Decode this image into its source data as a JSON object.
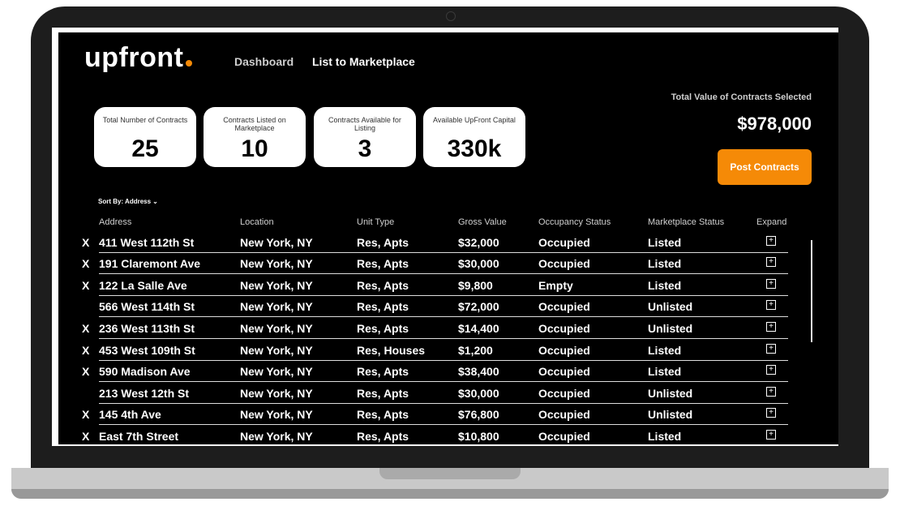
{
  "app": {
    "logo_text": "upfront",
    "accent_color": "#f58a07"
  },
  "nav": {
    "dashboard": "Dashboard",
    "list_to_marketplace": "List to Marketplace"
  },
  "stats": [
    {
      "label": "Total Number of Contracts",
      "value": "25"
    },
    {
      "label": "Contracts Listed on Marketplace",
      "value": "10"
    },
    {
      "label": "Contracts Available for Listing",
      "value": "3"
    },
    {
      "label": "Available UpFront Capital",
      "value": "330k"
    }
  ],
  "summary": {
    "total_label": "Total Value of Contracts Selected",
    "total_value": "$978,000",
    "post_button": "Post Contracts"
  },
  "sort": {
    "label": "Sort By: Address"
  },
  "table": {
    "headers": [
      "Address",
      "Location",
      "Unit Type",
      "Gross Value",
      "Occupancy Status",
      "Marketplace Status",
      "Expand"
    ],
    "rows": [
      {
        "selected": "X",
        "address": "411 West 112th St",
        "location": "New York, NY",
        "unit_type": "Res, Apts",
        "gross_value": "$32,000",
        "occupancy": "Occupied",
        "marketplace": "Listed"
      },
      {
        "selected": "X",
        "address": "191 Claremont Ave",
        "location": "New York, NY",
        "unit_type": "Res, Apts",
        "gross_value": "$30,000",
        "occupancy": "Occupied",
        "marketplace": "Listed"
      },
      {
        "selected": "X",
        "address": "122 La Salle Ave",
        "location": "New York, NY",
        "unit_type": "Res, Apts",
        "gross_value": "$9,800",
        "occupancy": "Empty",
        "marketplace": "Listed"
      },
      {
        "selected": "",
        "address": "566 West 114th St",
        "location": "New York, NY",
        "unit_type": "Res, Apts",
        "gross_value": "$72,000",
        "occupancy": "Occupied",
        "marketplace": "Unlisted"
      },
      {
        "selected": "X",
        "address": "236 West 113th St",
        "location": "New York, NY",
        "unit_type": "Res, Apts",
        "gross_value": "$14,400",
        "occupancy": "Occupied",
        "marketplace": "Unlisted"
      },
      {
        "selected": "X",
        "address": "453 West 109th St",
        "location": "New York, NY",
        "unit_type": "Res, Houses",
        "gross_value": "$1,200",
        "occupancy": "Occupied",
        "marketplace": "Listed"
      },
      {
        "selected": "X",
        "address": "590 Madison Ave",
        "location": "New York, NY",
        "unit_type": "Res, Apts",
        "gross_value": "$38,400",
        "occupancy": "Occupied",
        "marketplace": "Listed"
      },
      {
        "selected": "",
        "address": "213 West 12th St",
        "location": "New York, NY",
        "unit_type": "Res, Apts",
        "gross_value": "$30,000",
        "occupancy": "Occupied",
        "marketplace": "Unlisted"
      },
      {
        "selected": "X",
        "address": "145 4th Ave",
        "location": "New York, NY",
        "unit_type": "Res, Apts",
        "gross_value": "$76,800",
        "occupancy": "Occupied",
        "marketplace": "Unlisted"
      },
      {
        "selected": "X",
        "address": "East 7th Street",
        "location": "New York, NY",
        "unit_type": "Res, Apts",
        "gross_value": "$10,800",
        "occupancy": "Occupied",
        "marketplace": "Listed"
      }
    ]
  }
}
